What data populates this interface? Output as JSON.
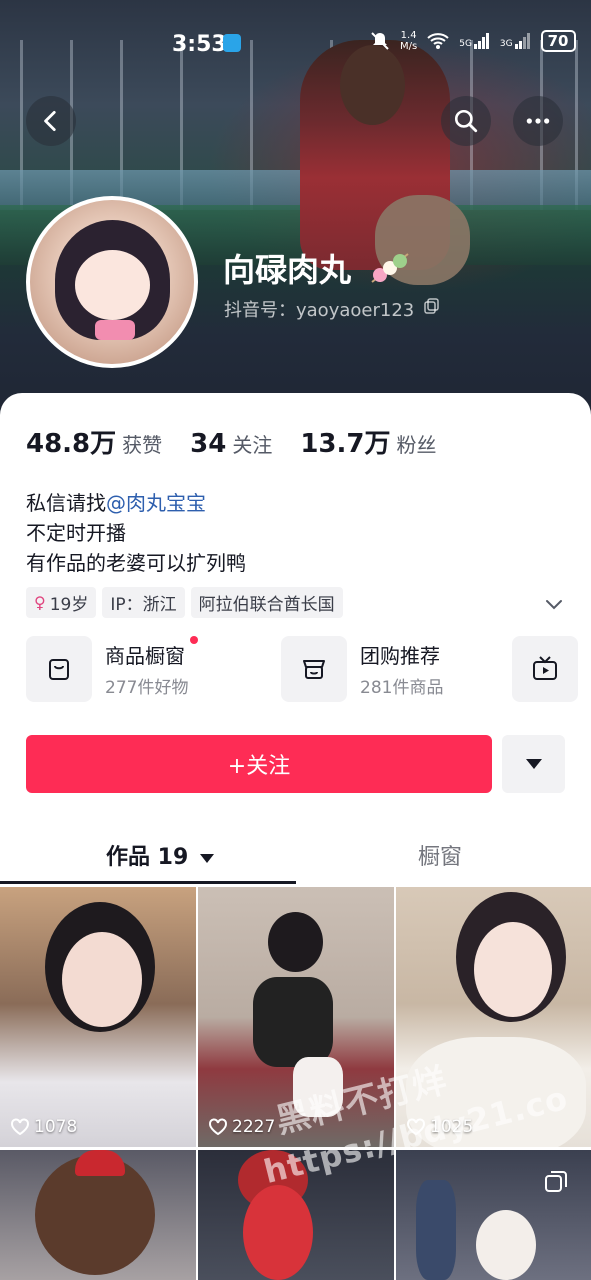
{
  "status_bar": {
    "time": "3:53",
    "net_speed_value": "1.4",
    "net_speed_unit": "M/s",
    "signal1": "5G",
    "signal2": "3G",
    "battery": "70"
  },
  "profile": {
    "name": "向碌肉丸",
    "douyin_id": "抖音号：yaoyaoer123",
    "stats": [
      {
        "value": "48.8万",
        "label": "获赞"
      },
      {
        "value": "34",
        "label": "关注"
      },
      {
        "value": "13.7万",
        "label": "粉丝"
      }
    ],
    "bio_line1_prefix": "私信请找",
    "bio_mention": "@肉丸宝宝",
    "bio_line2": "不定时开播",
    "bio_line3": "有作品的老婆可以扩列鸭",
    "tags": {
      "age": "19岁",
      "ip": "IP：浙江",
      "location": "阿拉伯联合酋长国"
    }
  },
  "shop": {
    "showcase_title": "商品橱窗",
    "showcase_sub": "277件好物",
    "group_title": "团购推荐",
    "group_sub": "281件商品"
  },
  "actions": {
    "follow_label": "+关注"
  },
  "tabs": {
    "works": "作品 19",
    "showcase": "橱窗"
  },
  "grid": {
    "likes": [
      "1078",
      "2227",
      "1025"
    ]
  },
  "watermark": {
    "line1": "黑料不打烊",
    "line2": "https://bdy21.co"
  },
  "colors": {
    "accent": "#fe2c55",
    "mention": "#2e5fae"
  }
}
